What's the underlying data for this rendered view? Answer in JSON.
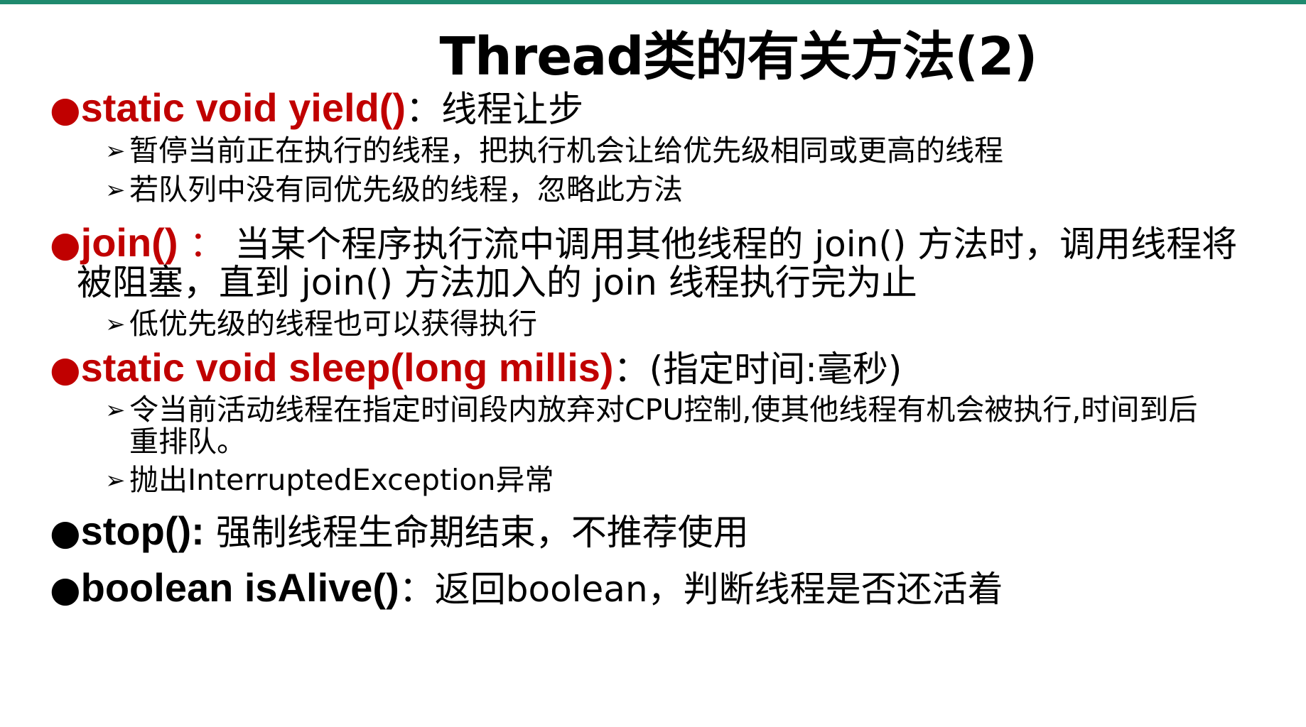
{
  "colors": {
    "top_line": "#1f8a6e",
    "method_red": "#c00000",
    "text": "#000000"
  },
  "title": "Thread类的有关方法(2)",
  "items": [
    {
      "bullet": "●",
      "method": "static  void  yield()",
      "separator": "：",
      "description": "线程让步",
      "subitems": [
        "暂停当前正在执行的线程，把执行机会让给优先级相同或更高的线程",
        "若队列中没有同优先级的线程，忽略此方法"
      ]
    },
    {
      "bullet": "●",
      "method": "join()",
      "separator": " ：",
      "description_line1": "当某个程序执行流中调用其他线程的 join() 方法时，调用线程将",
      "description_line2": "被阻塞，直到 join() 方法加入的 join 线程执行完为止",
      "subitems": [
        "低优先级的线程也可以获得执行"
      ]
    },
    {
      "bullet": "●",
      "method": "static  void  sleep(long millis)",
      "separator": "：",
      "description": "(指定时间:毫秒)",
      "subitems": [
        "令当前活动线程在指定时间段内放弃对CPU控制,使其他线程有机会被执行,时间到后",
        "重排队。",
        "抛出InterruptedException异常"
      ]
    },
    {
      "bullet": "●",
      "method": "stop():",
      "description": " 强制线程生命期结束，不推荐使用"
    },
    {
      "bullet": "●",
      "method": "boolean isAlive()",
      "separator": "：",
      "description": "返回boolean，判断线程是否还活着"
    }
  ],
  "sub_arrow": "➢"
}
